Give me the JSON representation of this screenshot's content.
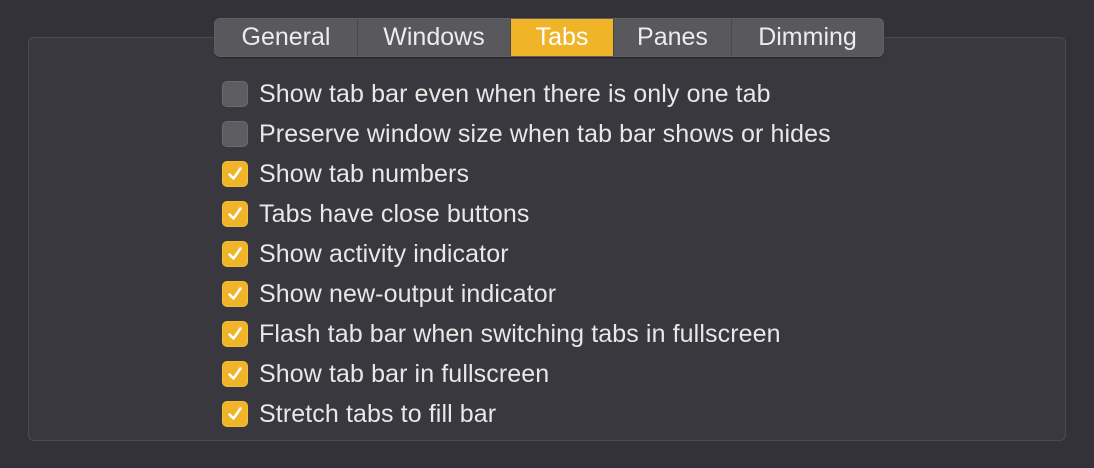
{
  "tabs": {
    "items": [
      {
        "label": "General",
        "selected": false
      },
      {
        "label": "Windows",
        "selected": false
      },
      {
        "label": "Tabs",
        "selected": true
      },
      {
        "label": "Panes",
        "selected": false
      },
      {
        "label": "Dimming",
        "selected": false
      }
    ]
  },
  "options": [
    {
      "label": "Show tab bar even when there is only one tab",
      "checked": false
    },
    {
      "label": "Preserve window size when tab bar shows or hides",
      "checked": false
    },
    {
      "label": "Show tab numbers",
      "checked": true
    },
    {
      "label": "Tabs have close buttons",
      "checked": true
    },
    {
      "label": "Show activity indicator",
      "checked": true
    },
    {
      "label": "Show new-output indicator",
      "checked": true
    },
    {
      "label": "Flash tab bar when switching tabs in fullscreen",
      "checked": true
    },
    {
      "label": "Show tab bar in fullscreen",
      "checked": true
    },
    {
      "label": "Stretch tabs to fill bar",
      "checked": true
    }
  ],
  "colors": {
    "accent": "#f0b429",
    "background": "#323238",
    "checkbox_off": "#5c5c61"
  }
}
